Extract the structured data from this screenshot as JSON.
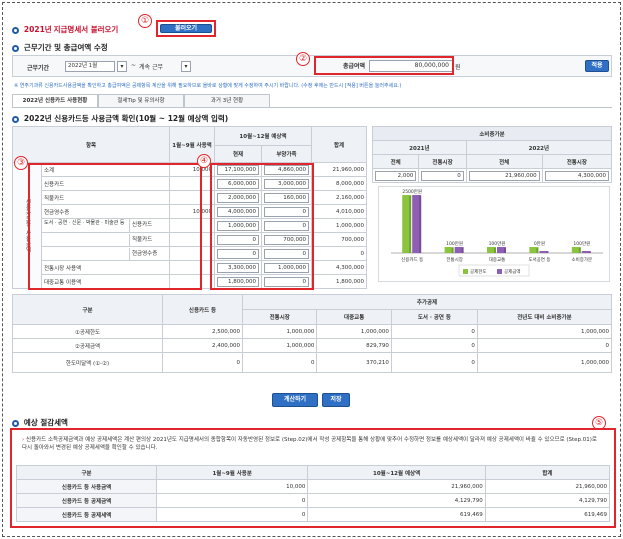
{
  "top": {
    "title_year": "2021년",
    "title_rest": "지급명세서 불러오기",
    "load_button": "불러오기",
    "callout_1": "①"
  },
  "section1": {
    "title": "근무기간 및 총급여액 수정",
    "period_label": "근무기간",
    "period_month": "2022년 1월",
    "period_sep": "~",
    "period_end": "계속 근무",
    "salary_label": "총급여액",
    "salary_value": "80,000,000",
    "salary_unit": "원",
    "apply_button": "적용",
    "callout_2": "②",
    "note": "※ 연주기과류 신용카드사용금액을 확인하고 총급여액은 공제항목 계산을 위해 필요하므로 올바로 상황에 맞게 수정하여 주시기 바랍니다. (수정 후에는 반드시 [적용] 버튼을 눌러주세요.)"
  },
  "tabs": [
    "2022년 신용카드 사용현황",
    "절세Tip 및 유의사항",
    "과거 3년 현황"
  ],
  "section2": {
    "title": "2022년 신용카드등 사용금액 확인(10월 ~ 12월 예상액 입력)",
    "col_item": "항목",
    "col_jan_sep": "1월~9월 사용액",
    "col_oct_dec": "10월~12월 예상액",
    "col_current": "현재",
    "col_plus": "부양가족",
    "col_total": "합계",
    "callout_3": "③",
    "callout_4": "④",
    "side_label_1": "신용카드등",
    "side_label_2": "사용금액",
    "rows": [
      {
        "label": "소계",
        "sub": "",
        "jan": "10,000",
        "cur": "17,100,000",
        "plus": "4,860,000",
        "total": "21,960,000"
      },
      {
        "label": "신용카드",
        "sub": "",
        "jan": "",
        "cur": "6,000,000",
        "plus": "3,000,000",
        "total": "8,000,000"
      },
      {
        "label": "직불카드",
        "sub": "",
        "jan": "",
        "cur": "2,000,000",
        "plus": "160,000",
        "total": "2,160,000"
      },
      {
        "label": "현금영수증",
        "sub": "",
        "jan": "10,000",
        "cur": "4,000,000",
        "plus": "0",
        "total": "4,010,000"
      },
      {
        "label": "도서 · 공연 · 신문 · 박물관 · 미술관 등",
        "sub": "신용카드",
        "jan": "",
        "cur": "1,000,000",
        "plus": "0",
        "total": "1,000,000"
      },
      {
        "label": "",
        "sub": "직불카드",
        "jan": "",
        "cur": "0",
        "plus": "700,000",
        "total": "700,000"
      },
      {
        "label": "",
        "sub": "현금영수증",
        "jan": "",
        "cur": "0",
        "plus": "0",
        "total": "0"
      },
      {
        "label": "전통시장 사용액",
        "sub": "",
        "jan": "",
        "cur": "3,300,000",
        "plus": "1,000,000",
        "total": "4,300,000"
      },
      {
        "label": "대중교통 이용액",
        "sub": "",
        "jan": "",
        "cur": "1,800,000",
        "plus": "0",
        "total": "1,800,000"
      }
    ]
  },
  "consumption": {
    "title": "소비증가분",
    "y2021": "2021년",
    "y2022": "2022년",
    "col_total": "전체",
    "col_market": "전통시장",
    "v2021_total": "2,000",
    "v2021_market": "0",
    "v2022_total": "21,960,000",
    "v2022_market": "4,300,000"
  },
  "chart_data": {
    "type": "bar",
    "categories": [
      "신용카드 등",
      "전통시장",
      "대중교통",
      "도서공연 등",
      "소비증가분"
    ],
    "series": [
      {
        "name": "공제한도",
        "values": [
          2500,
          100,
          100,
          100,
          100
        ],
        "color": "#8bc53f"
      },
      {
        "name": "공제금액",
        "values": [
          2500,
          100,
          100,
          0,
          0
        ],
        "color": "#8e5fb4"
      }
    ],
    "labels_top": [
      "2500만원",
      "100만원",
      "100만원",
      "0만원",
      "100만원"
    ]
  },
  "section3": {
    "col_type": "구분",
    "col_card": "신용카드 등",
    "col_extra": "추가공제",
    "col_market": "전통시장",
    "col_transport": "대중교통",
    "col_book": "도서 · 공연 등",
    "col_increase": "전년도 대비 소비증가분",
    "rows": [
      {
        "label": "①공제한도",
        "card": "2,500,000",
        "market": "1,000,000",
        "transport": "1,000,000",
        "book": "0",
        "increase": "1,000,000"
      },
      {
        "label": "②공제금액",
        "card": "2,400,000",
        "market": "1,000,000",
        "transport": "829,790",
        "book": "0",
        "increase": "0"
      },
      {
        "label": "한도미달액 (①-②)",
        "card": "0",
        "market": "0",
        "transport": "370,210",
        "book": "0",
        "increase": "1,000,000"
      }
    ],
    "calc_button": "계산하기",
    "save_button": "저장"
  },
  "section4": {
    "title": "예상 절감세액",
    "callout_5": "⑤",
    "note": "신용카드 소득공제금액과 예상 공제세액은 계산 편의상 2021년도 지급명세서의 종합항목이 자동반영된 정보로 (Step.02)에서 작성 공제항목을 통해 상황에 맞추어 수정하면 정보를 예상세액이 달라져 예상 공제세액이 바뀔 수 있으므로 (Step.01)로 다시 돌아와서 변경된 예상 공제세액을 확인할 수 있습니다.",
    "col_type": "구분",
    "col_jan_sep": "1월~9월 사용분",
    "col_oct_dec": "10월~12월 예상액",
    "col_total": "합계",
    "rows": [
      {
        "label": "신용카드 등 사용금액",
        "jan": "10,000",
        "oct": "21,960,000",
        "total": "21,960,000"
      },
      {
        "label": "신용카드 등 공제금액",
        "jan": "0",
        "oct": "4,129,790",
        "total": "4,129,790"
      },
      {
        "label": "신용카드 등 공제세액",
        "jan": "0",
        "oct": "619,469",
        "total": "619,469"
      }
    ]
  }
}
